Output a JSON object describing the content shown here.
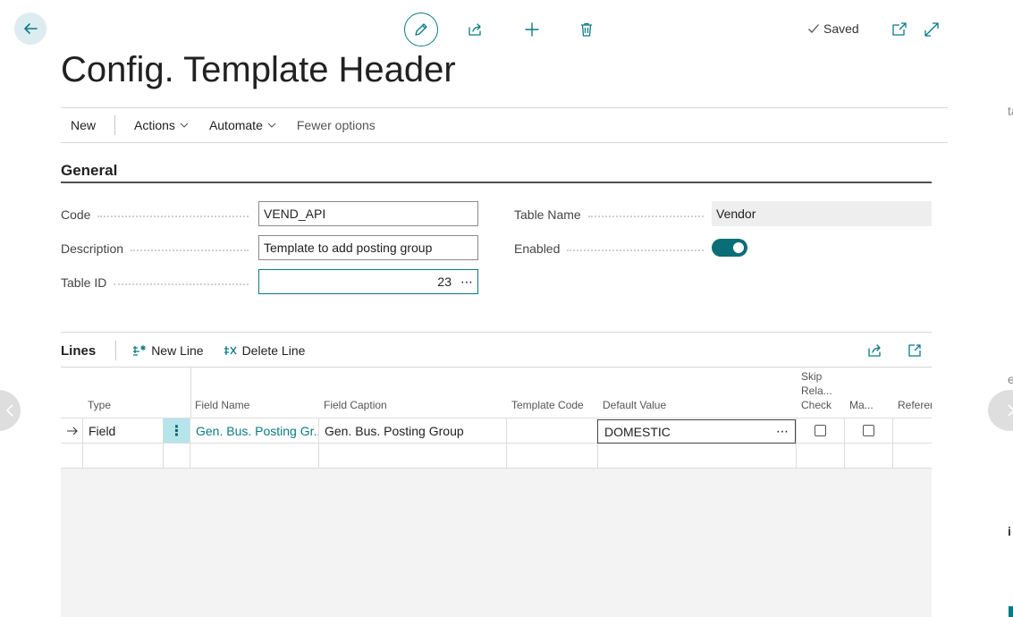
{
  "header": {
    "saved_label": "Saved",
    "page_title": "Config. Template Header"
  },
  "action_bar": {
    "new_label": "New",
    "actions_label": "Actions",
    "automate_label": "Automate",
    "fewer_options_label": "Fewer options"
  },
  "general": {
    "section_title": "General",
    "code_label": "Code",
    "code_value": "VEND_API",
    "description_label": "Description",
    "description_value": "Template to add posting group",
    "table_id_label": "Table ID",
    "table_id_value": "23",
    "table_name_label": "Table Name",
    "table_name_value": "Vendor",
    "enabled_label": "Enabled",
    "enabled_value": true
  },
  "lines": {
    "title": "Lines",
    "new_line_label": "New Line",
    "delete_line_label": "Delete Line",
    "columns": {
      "type": "Type",
      "field_name": "Field Name",
      "field_caption": "Field Caption",
      "template_code": "Template Code",
      "default_value": "Default Value",
      "skip_line1": "Skip",
      "skip_line2": "Rela...",
      "skip_line3": "Check",
      "mandatory": "Ma...",
      "reference": "Referen"
    },
    "rows": [
      {
        "type": "Field",
        "field_name": "Gen. Bus. Posting Gr...",
        "field_caption": "Gen. Bus. Posting Group",
        "template_code": "",
        "default_value": "DOMESTIC"
      }
    ]
  },
  "edge_glyphs": {
    "right_top": "ta",
    "right_mid": "e",
    "right_bottom": "i"
  },
  "colors": {
    "accent": "#0a7a83",
    "toggle_on": "#0a6e78",
    "selected_cell": "#b5e4ea"
  }
}
